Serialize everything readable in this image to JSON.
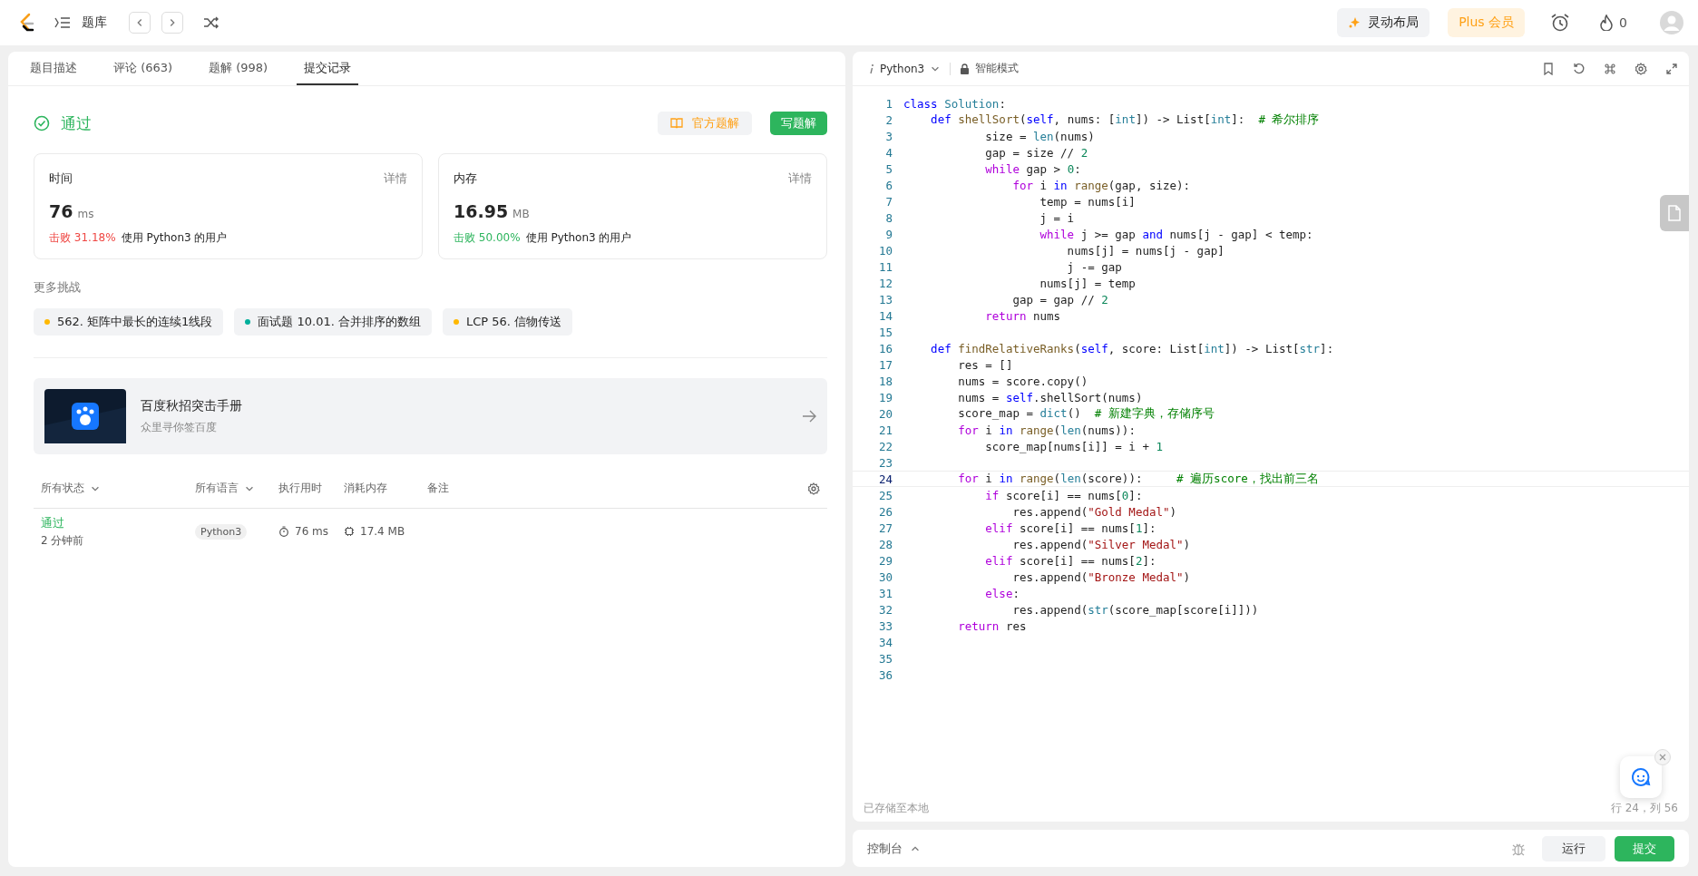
{
  "topbar": {
    "nav_label": "题库",
    "layout_button": "灵动布局",
    "plus_button": "Plus 会员",
    "streak": "0"
  },
  "tabs": [
    {
      "label": "题目描述",
      "selected": false
    },
    {
      "label": "评论 (663)",
      "selected": false
    },
    {
      "label": "题解 (998)",
      "selected": false
    },
    {
      "label": "提交记录",
      "selected": true
    }
  ],
  "result": {
    "status": "通过",
    "official_button": "官方题解",
    "write_button": "写题解"
  },
  "cards": [
    {
      "title": "时间",
      "detail": "详情",
      "value": "76",
      "unit": "ms",
      "beat": "击败 31.18%",
      "color": "#ef4743",
      "suffix": "使用 Python3 的用户"
    },
    {
      "title": "内存",
      "detail": "详情",
      "value": "16.95",
      "unit": "MB",
      "beat": "击败 50.00%",
      "color": "#2db55d",
      "suffix": "使用 Python3 的用户"
    }
  ],
  "more_title": "更多挑战",
  "challenges": [
    {
      "label": "562. 矩阵中最长的连续1线段",
      "color": "#ffb800"
    },
    {
      "label": "面试题 10.01. 合并排序的数组",
      "color": "#00af9b"
    },
    {
      "label": "LCP 56. 信物传送",
      "color": "#ffb800"
    }
  ],
  "banner": {
    "kind": "picture",
    "title": "百度秋招突击手册",
    "subtitle": "众里寻你签百度"
  },
  "table": {
    "columns": [
      {
        "label": "所有状态",
        "dropdown": true
      },
      {
        "label": "所有语言",
        "dropdown": true
      },
      {
        "label": "执行用时",
        "dropdown": false
      },
      {
        "label": "消耗内存",
        "dropdown": false
      },
      {
        "label": "备注",
        "dropdown": false
      }
    ],
    "rows": [
      {
        "status": "通过",
        "time_ago": "2 分钟前",
        "language": "Python3",
        "runtime": "76 ms",
        "memory": "17.4 MB"
      }
    ]
  },
  "editor": {
    "language": "Python3",
    "mode": "智能模式",
    "saved": "已存储至本地",
    "cursor": "行 24，列 56",
    "lines": [
      {
        "number": "1",
        "current": false,
        "tokens": [
          {
            "kind": "keyword",
            "text": "class"
          },
          {
            "kind": "type",
            "text": " Solution"
          },
          {
            "kind": "plain",
            "text": ":"
          }
        ]
      },
      {
        "number": "2",
        "current": false,
        "tokens": [
          {
            "kind": "keyword",
            "text": "    def"
          },
          {
            "kind": "function",
            "text": " shellSort"
          },
          {
            "kind": "plain",
            "text": "("
          },
          {
            "kind": "keyword",
            "text": "self"
          },
          {
            "kind": "plain",
            "text": ", nums: ["
          },
          {
            "kind": "type",
            "text": "int"
          },
          {
            "kind": "plain",
            "text": "]) -> List["
          },
          {
            "kind": "type",
            "text": "int"
          },
          {
            "kind": "plain",
            "text": "]:"
          },
          {
            "kind": "comment",
            "text": "  # 希尔排序"
          }
        ]
      },
      {
        "number": "3",
        "current": false,
        "tokens": [
          {
            "kind": "plain",
            "text": "            size = "
          },
          {
            "kind": "type",
            "text": "len"
          },
          {
            "kind": "plain",
            "text": "(nums)"
          }
        ]
      },
      {
        "number": "4",
        "current": false,
        "tokens": [
          {
            "kind": "plain",
            "text": "            gap = size // "
          },
          {
            "kind": "number",
            "text": "2"
          }
        ]
      },
      {
        "number": "5",
        "current": false,
        "tokens": [
          {
            "kind": "control",
            "text": "            while"
          },
          {
            "kind": "plain",
            "text": " gap > "
          },
          {
            "kind": "number",
            "text": "0"
          },
          {
            "kind": "plain",
            "text": ":"
          }
        ]
      },
      {
        "number": "6",
        "current": false,
        "tokens": [
          {
            "kind": "control",
            "text": "                for"
          },
          {
            "kind": "plain",
            "text": " i "
          },
          {
            "kind": "keyword",
            "text": "in"
          },
          {
            "kind": "function",
            "text": " range"
          },
          {
            "kind": "plain",
            "text": "(gap, size):"
          }
        ]
      },
      {
        "number": "7",
        "current": false,
        "tokens": [
          {
            "kind": "plain",
            "text": "                    temp = nums[i]"
          }
        ]
      },
      {
        "number": "8",
        "current": false,
        "tokens": [
          {
            "kind": "plain",
            "text": "                    j = i"
          }
        ]
      },
      {
        "number": "9",
        "current": false,
        "tokens": [
          {
            "kind": "control",
            "text": "                    while"
          },
          {
            "kind": "plain",
            "text": " j >= gap "
          },
          {
            "kind": "keyword",
            "text": "and"
          },
          {
            "kind": "plain",
            "text": " nums[j - gap] < temp:"
          }
        ]
      },
      {
        "number": "10",
        "current": false,
        "tokens": [
          {
            "kind": "plain",
            "text": "                        nums[j] = nums[j - gap]"
          }
        ]
      },
      {
        "number": "11",
        "current": false,
        "tokens": [
          {
            "kind": "plain",
            "text": "                        j -= gap"
          }
        ]
      },
      {
        "number": "12",
        "current": false,
        "tokens": [
          {
            "kind": "plain",
            "text": "                    nums[j] = temp"
          }
        ]
      },
      {
        "number": "13",
        "current": false,
        "tokens": [
          {
            "kind": "plain",
            "text": "                gap = gap // "
          },
          {
            "kind": "number",
            "text": "2"
          }
        ]
      },
      {
        "number": "14",
        "current": false,
        "tokens": [
          {
            "kind": "control",
            "text": "            return"
          },
          {
            "kind": "plain",
            "text": " nums"
          }
        ]
      },
      {
        "number": "15",
        "current": false
      },
      {
        "number": "16",
        "current": false,
        "tokens": [
          {
            "kind": "keyword",
            "text": "    def"
          },
          {
            "kind": "function",
            "text": " findRelativeRanks"
          },
          {
            "kind": "plain",
            "text": "("
          },
          {
            "kind": "keyword",
            "text": "self"
          },
          {
            "kind": "plain",
            "text": ", score: List["
          },
          {
            "kind": "type",
            "text": "int"
          },
          {
            "kind": "plain",
            "text": "]) -> List["
          },
          {
            "kind": "type",
            "text": "str"
          },
          {
            "kind": "plain",
            "text": "]:"
          }
        ]
      },
      {
        "number": "17",
        "current": false,
        "tokens": [
          {
            "kind": "plain",
            "text": "        res = []"
          }
        ]
      },
      {
        "number": "18",
        "current": false,
        "tokens": [
          {
            "kind": "plain",
            "text": "        nums = score.copy()"
          }
        ]
      },
      {
        "number": "19",
        "current": false,
        "tokens": [
          {
            "kind": "plain",
            "text": "        nums = "
          },
          {
            "kind": "keyword",
            "text": "self"
          },
          {
            "kind": "plain",
            "text": ".shellSort(nums)"
          }
        ]
      },
      {
        "number": "20",
        "current": false,
        "tokens": [
          {
            "kind": "plain",
            "text": "        score_map = "
          },
          {
            "kind": "type",
            "text": "dict"
          },
          {
            "kind": "plain",
            "text": "()"
          },
          {
            "kind": "comment",
            "text": "  # 新建字典，存储序号"
          }
        ]
      },
      {
        "number": "21",
        "current": false,
        "tokens": [
          {
            "kind": "control",
            "text": "        for"
          },
          {
            "kind": "plain",
            "text": " i "
          },
          {
            "kind": "keyword",
            "text": "in"
          },
          {
            "kind": "function",
            "text": " range"
          },
          {
            "kind": "plain",
            "text": "("
          },
          {
            "kind": "type",
            "text": "len"
          },
          {
            "kind": "plain",
            "text": "(nums)):"
          }
        ]
      },
      {
        "number": "22",
        "current": false,
        "tokens": [
          {
            "kind": "plain",
            "text": "            score_map[nums[i]] = i + "
          },
          {
            "kind": "number",
            "text": "1"
          }
        ]
      },
      {
        "number": "23",
        "current": false
      },
      {
        "number": "24",
        "current": true,
        "tokens": [
          {
            "kind": "control",
            "text": "        for"
          },
          {
            "kind": "plain",
            "text": " i "
          },
          {
            "kind": "keyword",
            "text": "in"
          },
          {
            "kind": "function",
            "text": " range"
          },
          {
            "kind": "plain",
            "text": "("
          },
          {
            "kind": "type",
            "text": "len"
          },
          {
            "kind": "plain",
            "text": "(score)):"
          },
          {
            "kind": "comment",
            "text": "     # 遍历score，找出前三名"
          }
        ]
      },
      {
        "number": "25",
        "current": false,
        "tokens": [
          {
            "kind": "control",
            "text": "            if"
          },
          {
            "kind": "plain",
            "text": " score[i] == nums["
          },
          {
            "kind": "number",
            "text": "0"
          },
          {
            "kind": "plain",
            "text": "]:"
          }
        ]
      },
      {
        "number": "26",
        "current": false,
        "tokens": [
          {
            "kind": "plain",
            "text": "                res.append("
          },
          {
            "kind": "string",
            "text": "\"Gold Medal\""
          },
          {
            "kind": "plain",
            "text": ")"
          }
        ]
      },
      {
        "number": "27",
        "current": false,
        "tokens": [
          {
            "kind": "control",
            "text": "            elif"
          },
          {
            "kind": "plain",
            "text": " score[i] == nums["
          },
          {
            "kind": "number",
            "text": "1"
          },
          {
            "kind": "plain",
            "text": "]:"
          }
        ]
      },
      {
        "number": "28",
        "current": false,
        "tokens": [
          {
            "kind": "plain",
            "text": "                res.append("
          },
          {
            "kind": "string",
            "text": "\"Silver Medal\""
          },
          {
            "kind": "plain",
            "text": ")"
          }
        ]
      },
      {
        "number": "29",
        "current": false,
        "tokens": [
          {
            "kind": "control",
            "text": "            elif"
          },
          {
            "kind": "plain",
            "text": " score[i] == nums["
          },
          {
            "kind": "number",
            "text": "2"
          },
          {
            "kind": "plain",
            "text": "]:"
          }
        ]
      },
      {
        "number": "30",
        "current": false,
        "tokens": [
          {
            "kind": "plain",
            "text": "                res.append("
          },
          {
            "kind": "string",
            "text": "\"Bronze Medal\""
          },
          {
            "kind": "plain",
            "text": ")"
          }
        ]
      },
      {
        "number": "31",
        "current": false,
        "tokens": [
          {
            "kind": "control",
            "text": "            else"
          },
          {
            "kind": "plain",
            "text": ":"
          }
        ]
      },
      {
        "number": "32",
        "current": false,
        "tokens": [
          {
            "kind": "plain",
            "text": "                res.append("
          },
          {
            "kind": "type",
            "text": "str"
          },
          {
            "kind": "plain",
            "text": "(score_map[score[i]]))"
          }
        ]
      },
      {
        "number": "33",
        "current": false,
        "tokens": [
          {
            "kind": "control",
            "text": "        return"
          },
          {
            "kind": "plain",
            "text": " res"
          }
        ]
      },
      {
        "number": "34",
        "current": false
      },
      {
        "number": "35",
        "current": false
      },
      {
        "number": "36",
        "current": false
      }
    ]
  },
  "console": {
    "label": "控制台",
    "run_button": "运行",
    "submit_button": "提交"
  }
}
